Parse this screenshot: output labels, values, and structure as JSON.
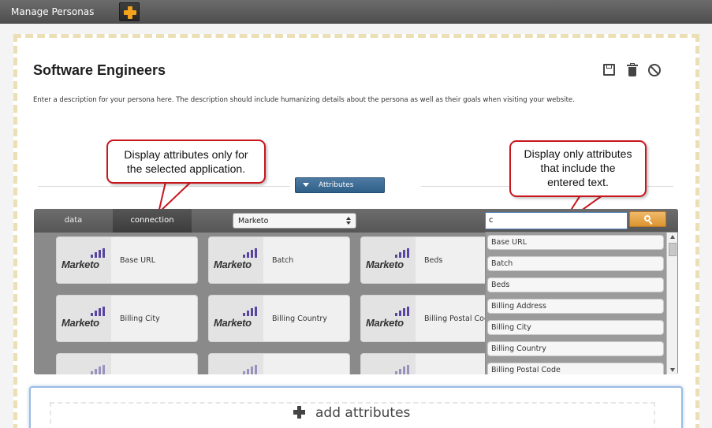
{
  "topbar": {
    "title": "Manage Personas"
  },
  "persona": {
    "title": "Software Engineers",
    "description": "Enter a description for your persona here.  The description should include humanizing details about the persona as well as their goals when visiting your website."
  },
  "callouts": {
    "left": "Display attributes only for\nthe selected application.",
    "right": "Display only attributes\nthat include the\nentered text."
  },
  "attributes_toggle": {
    "label": "Attributes"
  },
  "tabs": [
    {
      "label": "data"
    },
    {
      "label": "connection"
    }
  ],
  "app_select": {
    "value": "Marketo"
  },
  "search": {
    "value": "c"
  },
  "tiles": [
    {
      "logo": "Marketo",
      "label": "Base URL"
    },
    {
      "logo": "Marketo",
      "label": "Batch"
    },
    {
      "logo": "Marketo",
      "label": "Beds"
    },
    {
      "logo": "Marketo",
      "label": "Billing City"
    },
    {
      "logo": "Marketo",
      "label": "Billing Country"
    },
    {
      "logo": "Marketo",
      "label": "Billing Postal Code"
    }
  ],
  "dropdown_items": [
    "Base URL",
    "Batch",
    "Beds",
    "Billing Address",
    "Billing City",
    "Billing Country",
    "Billing Postal Code"
  ],
  "add_attributes": {
    "label": "add attributes"
  },
  "colors": {
    "callout_border": "#c8161d",
    "accent_orange": "#f3a21c",
    "toggle_blue": "#2f5e86",
    "marketo_purple": "#5944a0"
  }
}
